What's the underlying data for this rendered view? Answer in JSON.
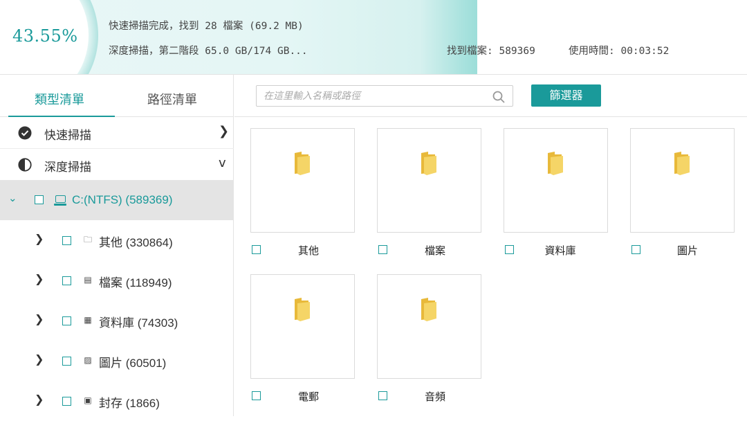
{
  "header": {
    "percent": "43.55%",
    "quick_scan_status": "快速掃描完成，找到 28 檔案 (69.2 MB)",
    "deep_scan_status": "深度掃描，第二階段 65.0 GB/174 GB...",
    "found_files": "找到檔案: 589369",
    "time_used": "使用時間: 00:03:52",
    "progress_fraction": 0.4355,
    "accent_color": "#1a9a9a"
  },
  "tabs": [
    "類型清單",
    "路徑清單"
  ],
  "scan_sections": [
    {
      "label": "快速掃描",
      "icon": "check-circle-icon",
      "chevron": "❯"
    },
    {
      "label": "深度掃描",
      "icon": "half-circle-icon",
      "chevron": "v"
    }
  ],
  "drive": {
    "label": "C:(NTFS) (589369)",
    "icon": "drive-icon"
  },
  "categories": [
    {
      "label": "其他 (330864)",
      "icon": "folder-outline-icon",
      "glyph": "🗀"
    },
    {
      "label": "檔案 (118949)",
      "icon": "document-icon",
      "glyph": "▤"
    },
    {
      "label": "資料庫  (74303)",
      "icon": "database-icon",
      "glyph": "▦"
    },
    {
      "label": "圖片 (60501)",
      "icon": "image-icon",
      "glyph": "▨"
    },
    {
      "label": "封存 (1866)",
      "icon": "archive-icon",
      "glyph": "▣"
    }
  ],
  "search": {
    "placeholder": "在這里輸入名稱或路徑"
  },
  "filter_button": "篩選器",
  "folders": [
    "其他",
    "檔案",
    "資料庫",
    "圖片",
    "電郵",
    "音頻"
  ]
}
